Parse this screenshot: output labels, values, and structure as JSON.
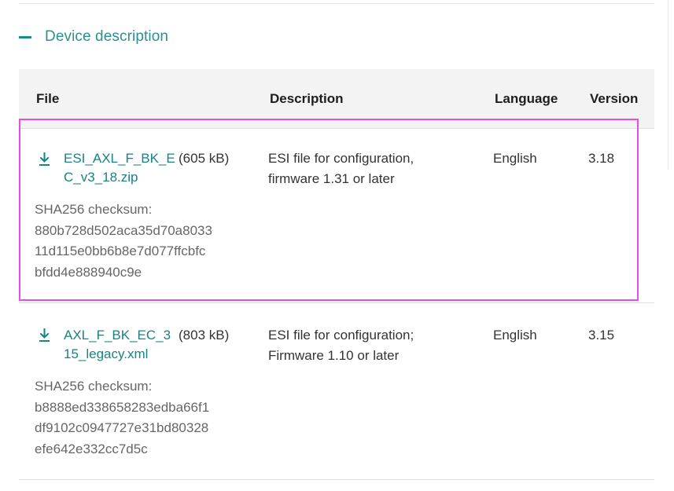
{
  "section": {
    "title": "Device description"
  },
  "table": {
    "headers": {
      "file": "File",
      "description": "Description",
      "language": "Language",
      "version": "Version"
    },
    "rows": [
      {
        "file_name": "ESI_AXL_F_BK_EC_v3_18.zip",
        "file_name_line1": "ESI_AXL_F_BK_E",
        "file_name_line2": "C_v3_18.zip",
        "size": "(605 kB)",
        "checksum_label": "SHA256 checksum:",
        "checksum_lines": [
          "880b728d502aca35d70a8033",
          "11d115e0bb6b8e7d077ffcbfc",
          "bfdd4e888940c9e"
        ],
        "description_lines": [
          "ESI file for configuration,",
          "firmware 1.31 or later"
        ],
        "language": "English",
        "version": "3.18"
      },
      {
        "file_name": "AXL_F_BK_EC_315_legacy.xml",
        "file_name_line1": "AXL_F_BK_EC_3",
        "file_name_line2": "15_legacy.xml",
        "size": "(803 kB)",
        "checksum_label": "SHA256 checksum:",
        "checksum_lines": [
          "b8888ed338658283edba66f1",
          "df9102c0947727e31bd80328",
          "efe642e332cc7d5c"
        ],
        "description_lines": [
          "ESI file for configuration;",
          "Firmware 1.10 or later"
        ],
        "language": "English",
        "version": "3.15"
      }
    ]
  },
  "colors": {
    "accent": "#1a8282",
    "highlight": "#e84be8",
    "header_bg": "#f3f3f3"
  },
  "icons": {
    "collapse": "minus-icon",
    "download": "download-icon"
  }
}
